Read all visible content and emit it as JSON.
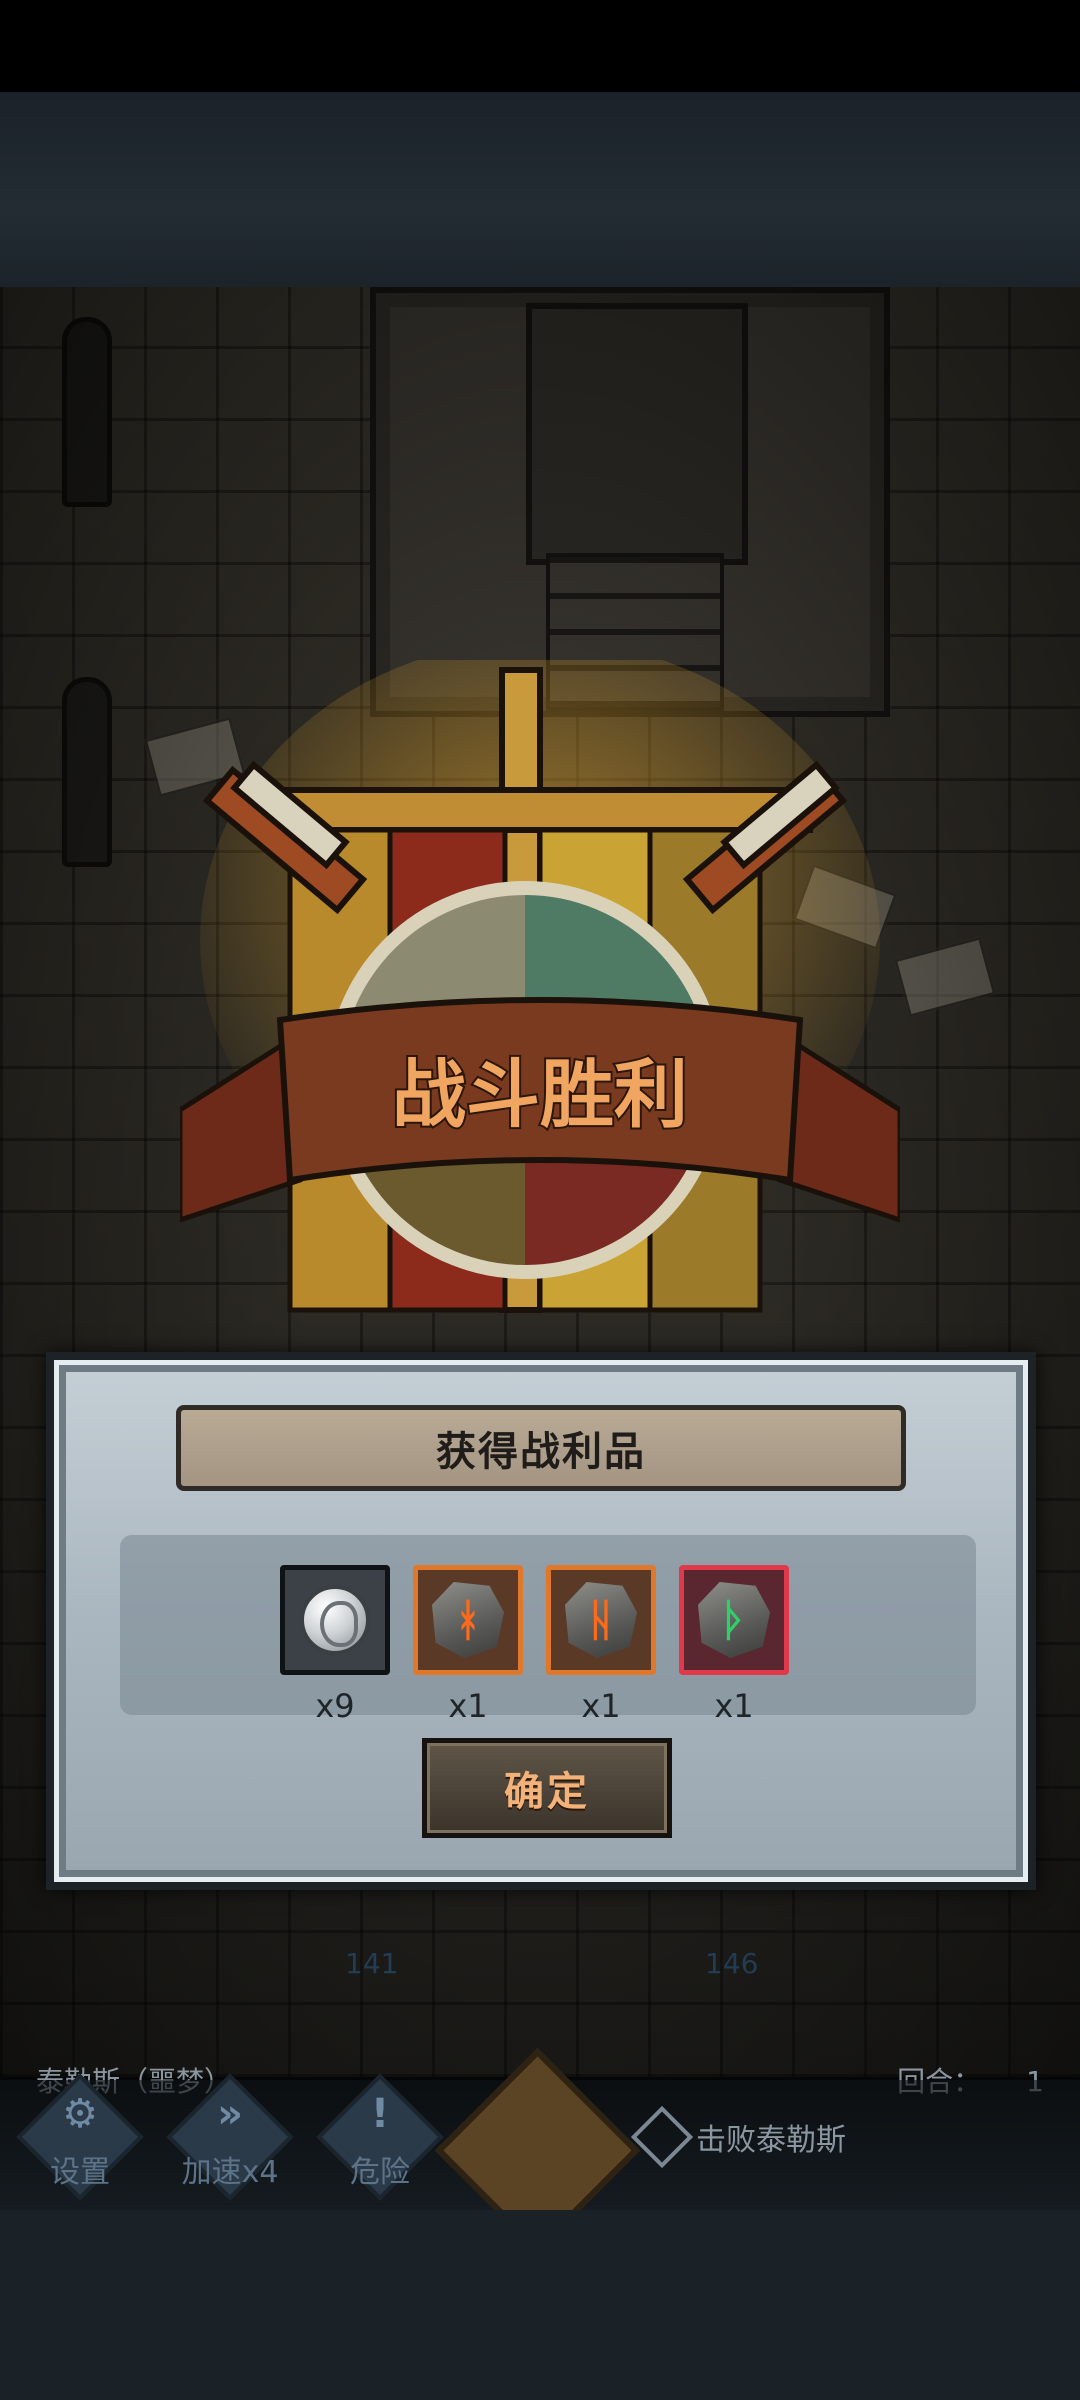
{
  "victory_banner": {
    "title": "战斗胜利"
  },
  "loot": {
    "title": "获得战利品",
    "items": [
      {
        "icon": "silver-coin-icon",
        "count": "x9",
        "frame_color": "#1b1f22",
        "glyph": ""
      },
      {
        "icon": "fire-rune-icon",
        "count": "x1",
        "frame_color": "#e0782c",
        "glyph": "ᚼ",
        "glyph_color": "#ff6a1a"
      },
      {
        "icon": "fire-rune-icon",
        "count": "x1",
        "frame_color": "#e0782c",
        "glyph": "ᚺ",
        "glyph_color": "#ff6a1a"
      },
      {
        "icon": "nature-rune-icon",
        "count": "x1",
        "frame_color": "#e0394b",
        "glyph": "ᚦ",
        "glyph_color": "#2fd06a"
      }
    ],
    "confirm_label": "确定"
  },
  "battle": {
    "hp_left": "141",
    "hp_right": "146"
  },
  "hud": {
    "boss_name": "泰勒斯（噩梦）",
    "round_label": "回合：",
    "round_value": "1",
    "buttons": {
      "settings": "设置",
      "speed": "加速x4",
      "danger": "危险"
    },
    "objective": "击败泰勒斯"
  },
  "colors": {
    "banner_red": "#7a3a1f",
    "title_orange": "#f0a561",
    "accent_gold": "#e0a32a"
  }
}
